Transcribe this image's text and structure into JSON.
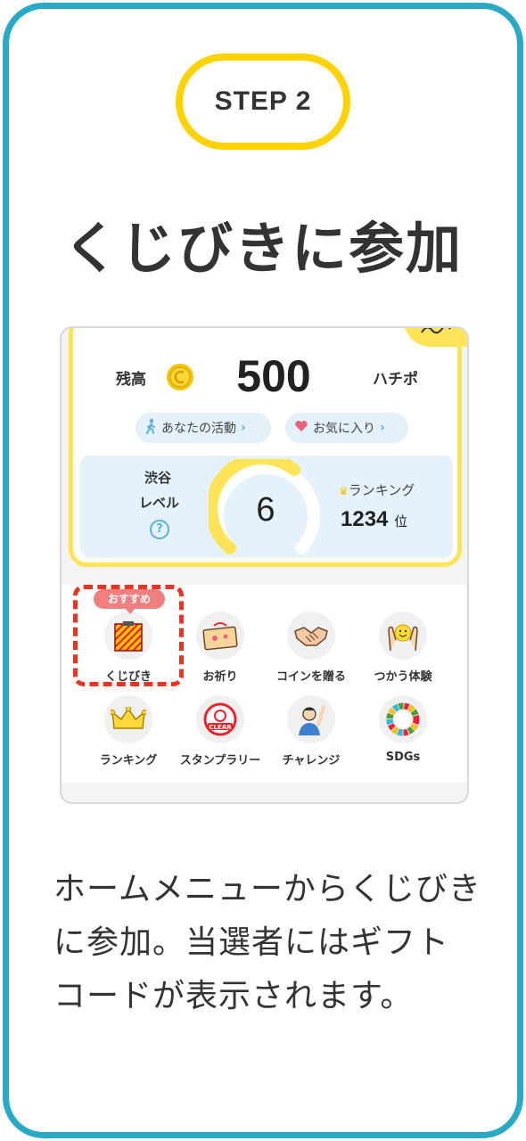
{
  "step_label": "STEP 2",
  "title": "くじびきに参加",
  "app": {
    "balance": {
      "label": "残高",
      "value": "500",
      "unit": "ハチポ"
    },
    "chips": [
      {
        "label": "あなたの活動",
        "icon": "walking-person-icon"
      },
      {
        "label": "お気に入り",
        "icon": "heart-icon"
      }
    ],
    "level": {
      "place": "渋谷",
      "label": "レベル",
      "help": "?",
      "value": "6",
      "ranking_label": "ランキング",
      "ranking_value": "1234",
      "ranking_suffix": "位"
    },
    "recommend_badge": "おすすめ",
    "menu": [
      {
        "label": "くじびき",
        "icon": "lottery-box-icon"
      },
      {
        "label": "お祈り",
        "icon": "prayer-envelope-icon"
      },
      {
        "label": "コインを贈る",
        "icon": "handshake-icon"
      },
      {
        "label": "つかう体験",
        "icon": "hands-smile-icon"
      },
      {
        "label": "ランキング",
        "icon": "crown-icon"
      },
      {
        "label": "スタンプラリー",
        "icon": "stamp-clear-icon"
      },
      {
        "label": "チャレンジ",
        "icon": "challenge-person-icon"
      },
      {
        "label": "SDGs",
        "icon": "sdgs-wheel-icon"
      }
    ]
  },
  "description": "ホームメニューからくじびきに参加。当選者にはギフトコードが表示されます。",
  "colors": {
    "frame": "#2aa9c4",
    "step_border": "#ffd200",
    "card_border": "#ffe45a",
    "highlight": "#ea3323",
    "badge": "#f08080"
  }
}
